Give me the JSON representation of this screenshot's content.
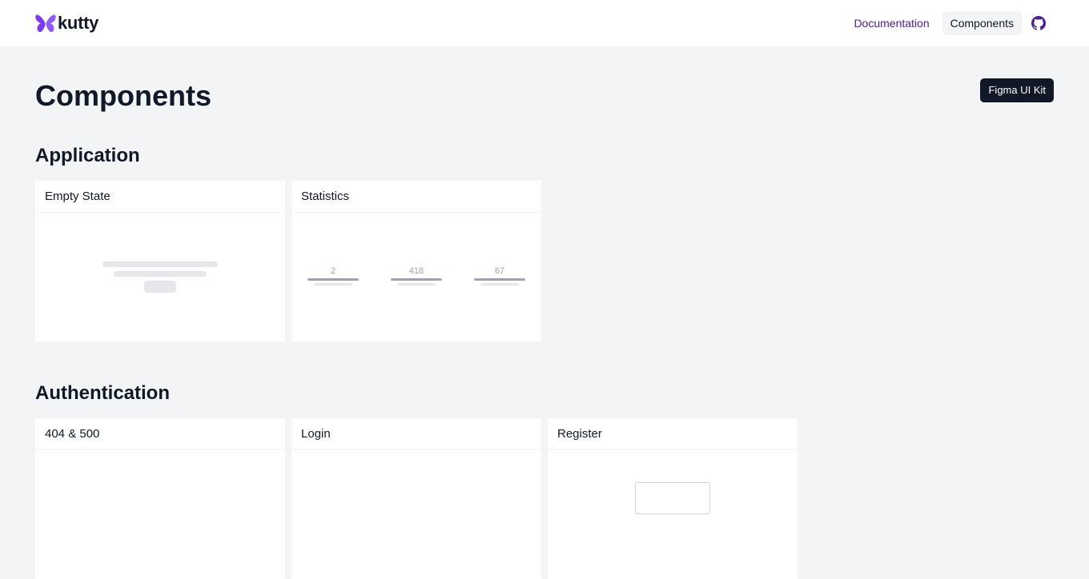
{
  "header": {
    "logo_text": "kutty",
    "logo_icon": "butterfly-icon",
    "nav": [
      {
        "label": "Documentation",
        "active": false
      },
      {
        "label": "Components",
        "active": true
      }
    ],
    "github_icon": "github-icon"
  },
  "page": {
    "title": "Components",
    "figma_button": "Figma UI Kit"
  },
  "sections": [
    {
      "title": "Application",
      "cards": [
        {
          "title": "Empty State"
        },
        {
          "title": "Statistics",
          "stats": [
            "2",
            "418",
            "67"
          ]
        }
      ]
    },
    {
      "title": "Authentication",
      "cards": [
        {
          "title": "404 & 500"
        },
        {
          "title": "Login"
        },
        {
          "title": "Register"
        }
      ]
    }
  ],
  "colors": {
    "accent": "#7c3aed",
    "page_bg": "#f3f4f6",
    "text_dark": "#111827",
    "nav_link": "#4c1d95"
  }
}
